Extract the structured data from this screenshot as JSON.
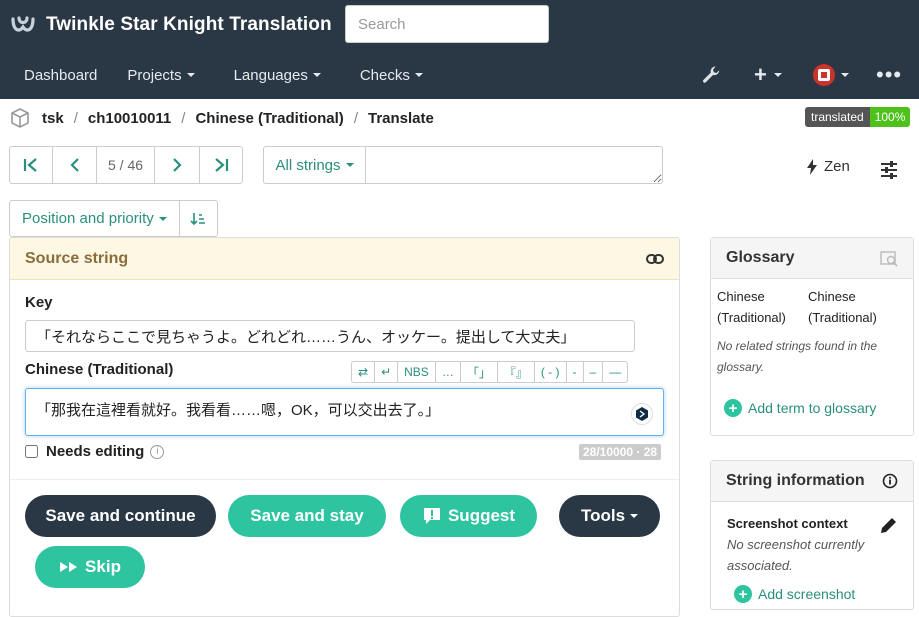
{
  "header": {
    "title": "Twinkle Star Knight Translation",
    "search_placeholder": "Search",
    "nav": [
      "Dashboard",
      "Projects",
      "Languages",
      "Checks"
    ]
  },
  "breadcrumb": {
    "items": [
      "tsk",
      "ch10010011",
      "Chinese (Traditional)",
      "Translate"
    ],
    "badge_label": "translated",
    "badge_value": "100%"
  },
  "pager": {
    "position": "5 / 46"
  },
  "filter": {
    "label": "All strings",
    "query": ""
  },
  "zen_label": "Zen",
  "sort_label": "Position and priority",
  "source": {
    "panel_title": "Source string",
    "key_label": "Key",
    "key_value": "「それならここで見ちゃうよ。どれどれ……うん、オッケー。提出して大丈夫」",
    "translation_label": "Chinese (Traditional)",
    "translation_value": "「那我在這裡看就好。我看看……嗯，OK，可以交出去了。」",
    "charbar": [
      "⇄",
      "↵",
      "NBS",
      "…",
      "「」",
      "『』",
      "( - )",
      "-",
      "–",
      "—"
    ],
    "needs_editing": "Needs editing",
    "counter": "28/10000 · 28"
  },
  "actions": {
    "save_continue": "Save and continue",
    "save_stay": "Save and stay",
    "suggest": "Suggest",
    "tools": "Tools",
    "skip": "Skip"
  },
  "glossary": {
    "title": "Glossary",
    "col1": "Chinese (Traditional)",
    "col2": "Chinese (Traditional)",
    "empty": "No related strings found in the glossary.",
    "add": "Add term to glossary"
  },
  "string_info": {
    "title": "String information",
    "screenshot_title": "Screenshot context",
    "screenshot_note": "No screenshot currently associated.",
    "add": "Add screenshot"
  },
  "colors": {
    "header_bg": "#2a3744",
    "accent": "#2a8f7c",
    "green_button": "#2ec4a0",
    "dark_button": "#2a3744",
    "badge_ok": "#4ec11c"
  }
}
